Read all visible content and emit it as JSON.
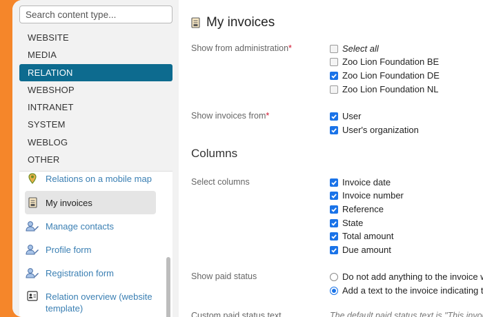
{
  "sidebar": {
    "search_placeholder": "Search content type...",
    "categories": [
      "WEBSITE",
      "MEDIA",
      "RELATION",
      "WEBSHOP",
      "INTRANET",
      "SYSTEM",
      "WEBLOG",
      "OTHER"
    ],
    "active_category": "RELATION",
    "items": [
      {
        "label": "Relations on a mobile map",
        "icon": "map-pin-icon"
      },
      {
        "label": "My invoices",
        "icon": "invoice-icon"
      },
      {
        "label": "Manage contacts",
        "icon": "user-edit-icon"
      },
      {
        "label": "Profile form",
        "icon": "user-edit-icon"
      },
      {
        "label": "Registration form",
        "icon": "user-edit-icon"
      },
      {
        "label": "Relation overview (website template)",
        "icon": "contact-card-icon"
      }
    ]
  },
  "main": {
    "title": "My invoices",
    "administration": {
      "label": "Show from administration",
      "required_mark": "*",
      "options": [
        {
          "label": "Select all",
          "checked": false
        },
        {
          "label": "Zoo Lion Foundation BE",
          "checked": false
        },
        {
          "label": "Zoo Lion Foundation DE",
          "checked": true
        },
        {
          "label": "Zoo Lion Foundation NL",
          "checked": false
        }
      ]
    },
    "invoices_from": {
      "label": "Show invoices from",
      "required_mark": "*",
      "options": [
        {
          "label": "User",
          "checked": true
        },
        {
          "label": "User's organization",
          "checked": true
        }
      ]
    },
    "columns_heading": "Columns",
    "select_columns": {
      "label": "Select columns",
      "options": [
        {
          "label": "Invoice date",
          "checked": true
        },
        {
          "label": "Invoice number",
          "checked": true
        },
        {
          "label": "Reference",
          "checked": true
        },
        {
          "label": "State",
          "checked": true
        },
        {
          "label": "Total amount",
          "checked": true
        },
        {
          "label": "Due amount",
          "checked": true
        }
      ]
    },
    "paid_status": {
      "label": "Show paid status",
      "options": [
        {
          "label": "Do not add anything to the invoice whe",
          "selected": false
        },
        {
          "label": "Add a text to the invoice indicating that",
          "selected": true
        }
      ]
    },
    "custom_paid_status": {
      "label": "Custom paid status text",
      "hint": "The default paid status text is \"This invoic"
    }
  },
  "colors": {
    "accent": "#f5862a",
    "active": "#0d6b8f",
    "link": "#3a7fb3",
    "checkbox": "#1a73e8"
  }
}
